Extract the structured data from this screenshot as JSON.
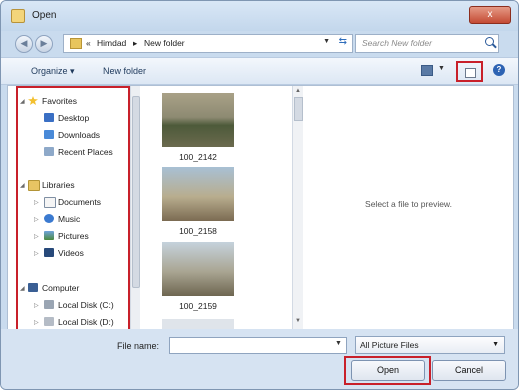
{
  "window": {
    "title": "Open",
    "close_label": "x"
  },
  "address": {
    "crumbs": [
      "«",
      "Himdad",
      "▸",
      "New folder"
    ],
    "search_placeholder": "Search New folder"
  },
  "toolbar": {
    "organize_label": "Organize ▾",
    "new_folder_label": "New folder"
  },
  "nav": {
    "favorites": {
      "label": "Favorites",
      "items": [
        "Desktop",
        "Downloads",
        "Recent Places"
      ]
    },
    "libraries": {
      "label": "Libraries",
      "items": [
        "Documents",
        "Music",
        "Pictures",
        "Videos"
      ]
    },
    "computer": {
      "label": "Computer",
      "items": [
        "Local Disk (C:)",
        "Local Disk (D:)"
      ]
    }
  },
  "files": [
    {
      "name": "100_2142"
    },
    {
      "name": "100_2158"
    },
    {
      "name": "100_2159"
    }
  ],
  "preview": {
    "message": "Select a file to preview."
  },
  "bottom": {
    "filename_label": "File name:",
    "filename_value": "",
    "filter_value": "All Picture Files",
    "open_label": "Open",
    "cancel_label": "Cancel"
  }
}
